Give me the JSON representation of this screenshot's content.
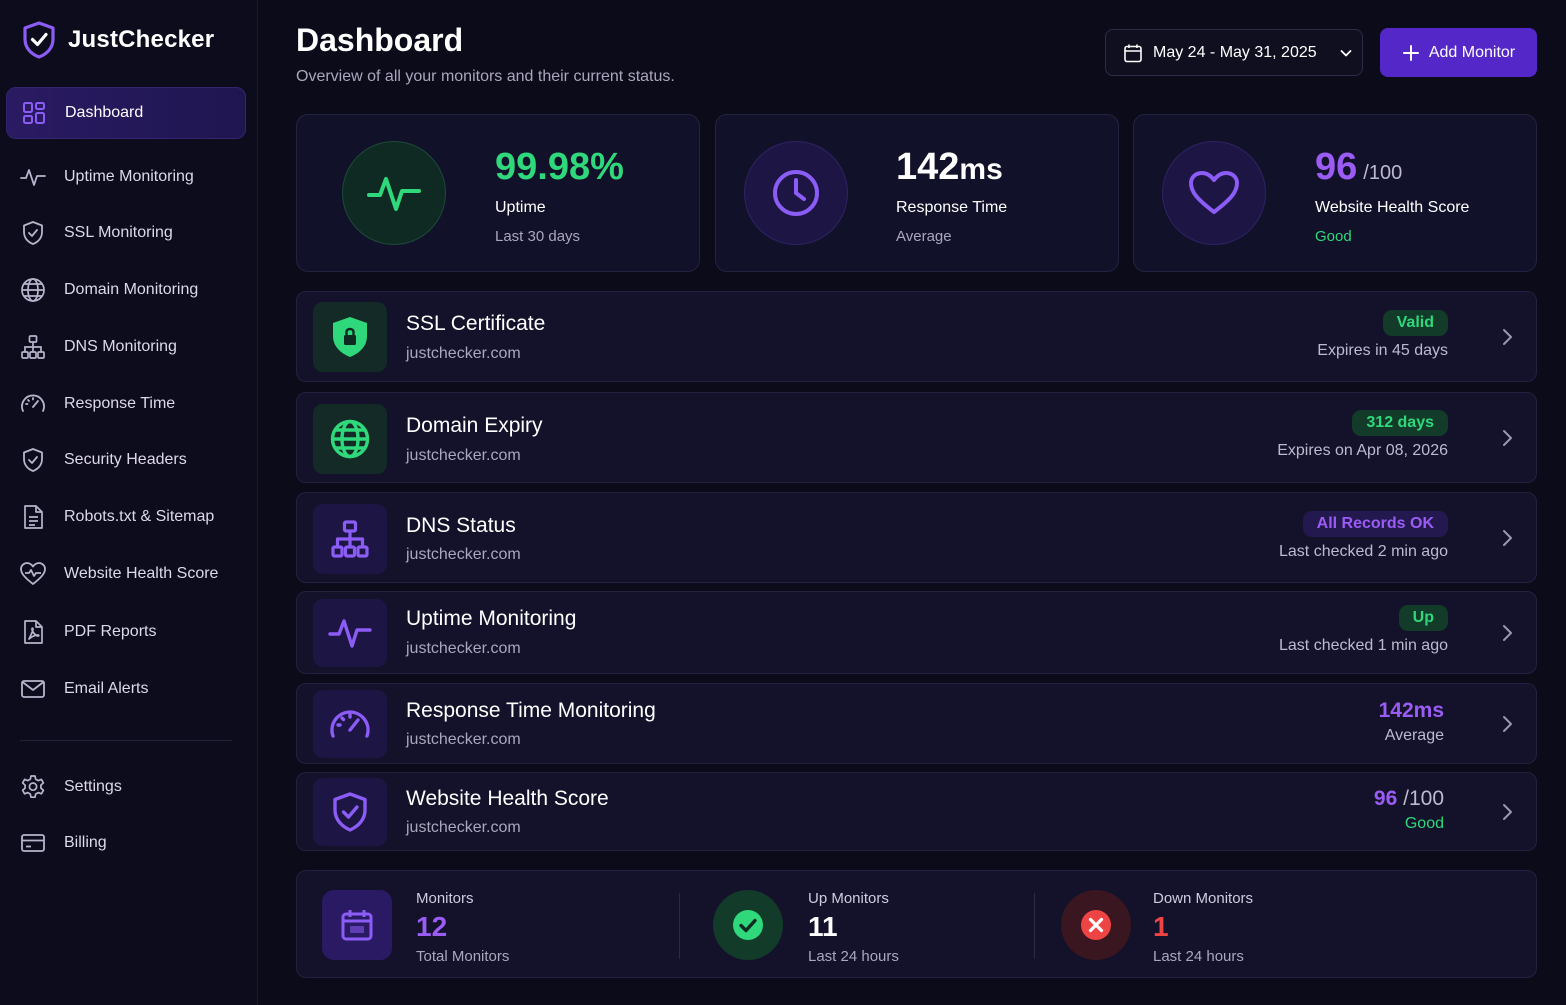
{
  "brand": {
    "name": "JustChecker"
  },
  "sidebar": {
    "items": [
      {
        "label": "Dashboard",
        "icon": "grid-icon",
        "active": true
      },
      {
        "label": "Uptime Monitoring",
        "icon": "pulse-icon"
      },
      {
        "label": "SSL Monitoring",
        "icon": "shield-check-icon"
      },
      {
        "label": "Domain Monitoring",
        "icon": "globe-icon"
      },
      {
        "label": "DNS Monitoring",
        "icon": "network-icon"
      },
      {
        "label": "Response Time",
        "icon": "speedometer-icon"
      },
      {
        "label": "Security Headers",
        "icon": "shield-check-icon"
      },
      {
        "label": "Robots.txt & Sitemap",
        "icon": "document-icon"
      },
      {
        "label": "Website Health Score",
        "icon": "heart-pulse-icon"
      },
      {
        "label": "PDF Reports",
        "icon": "pdf-icon"
      },
      {
        "label": "Email Alerts",
        "icon": "mail-icon"
      }
    ],
    "bottom": [
      {
        "label": "Settings",
        "icon": "gear-icon"
      },
      {
        "label": "Billing",
        "icon": "credit-card-icon"
      }
    ]
  },
  "header": {
    "title": "Dashboard",
    "subtitle": "Overview of all your monitors and their current status.",
    "date_range": "May 24 - May 31, 2025",
    "add_button": "Add Monitor"
  },
  "stats": {
    "uptime": {
      "value": "99.98%",
      "label": "Uptime",
      "sub": "Last 30 days"
    },
    "response": {
      "value": "142",
      "unit": "ms",
      "label": "Response Time",
      "sub": "Average"
    },
    "health": {
      "value": "96",
      "max": "/100",
      "label": "Website Health Score",
      "sub": "Good"
    }
  },
  "monitors": [
    {
      "title": "SSL Certificate",
      "domain": "justchecker.com",
      "badge": "Valid",
      "sub": "Expires in 45 days"
    },
    {
      "title": "Domain Expiry",
      "domain": "justchecker.com",
      "badge": "312 days",
      "sub": "Expires on Apr 08, 2026"
    },
    {
      "title": "DNS Status",
      "domain": "justchecker.com",
      "badge": "All Records OK",
      "sub": "Last checked 2 min ago"
    },
    {
      "title": "Uptime Monitoring",
      "domain": "justchecker.com",
      "badge": "Up",
      "sub": "Last checked 1 min ago"
    },
    {
      "title": "Response Time Monitoring",
      "domain": "justchecker.com",
      "value": "142ms",
      "sub": "Average"
    },
    {
      "title": "Website Health Score",
      "domain": "justchecker.com",
      "value": "96",
      "max": "/100",
      "sub": "Good"
    }
  ],
  "summary": {
    "total": {
      "label": "Monitors",
      "value": "12",
      "sub": "Total Monitors"
    },
    "up": {
      "label": "Up Monitors",
      "value": "11",
      "sub": "Last 24 hours"
    },
    "down": {
      "label": "Down Monitors",
      "value": "1",
      "sub": "Last 24 hours"
    }
  },
  "colors": {
    "accent": "#5427c9",
    "green": "#2fd87a",
    "purple": "#9b5cf6",
    "red": "#ef4444",
    "background": "#0c0b1a"
  }
}
